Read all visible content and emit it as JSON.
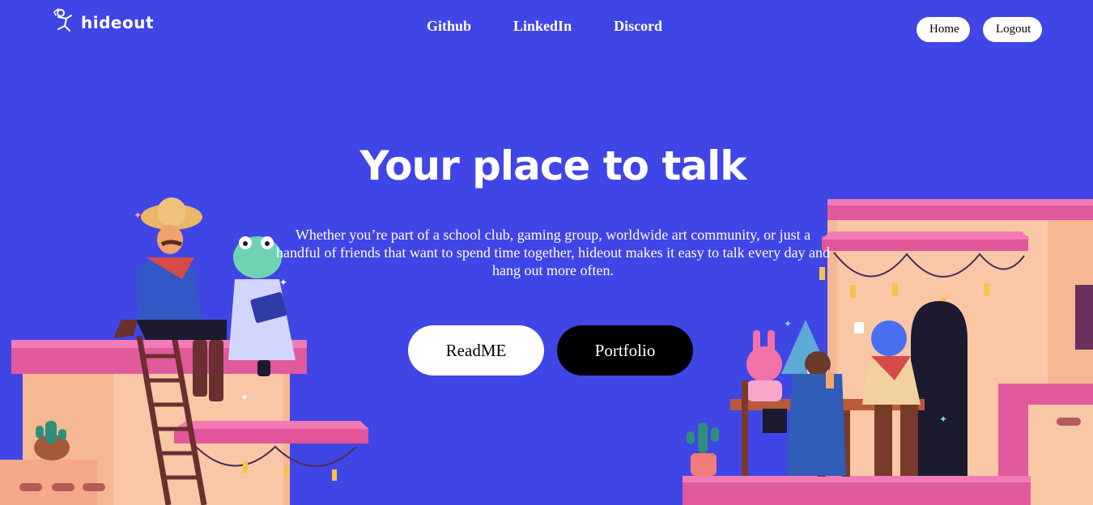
{
  "brand": {
    "name": "hideout"
  },
  "nav": {
    "links": [
      "Github",
      "LinkedIn",
      "Discord"
    ],
    "home_label": "Home",
    "logout_label": "Logout"
  },
  "hero": {
    "title": "Your place to talk",
    "text": "Whether you’re part of a school club, gaming group, worldwide art community, or just a handful of friends that want to spend time together, hideout makes it easy to talk every day and hang out more often.",
    "readme_label": "ReadME",
    "portfolio_label": "Portfolio"
  },
  "colors": {
    "background": "#4045e6",
    "primary_button": "#ffffff",
    "secondary_button": "#000000"
  }
}
